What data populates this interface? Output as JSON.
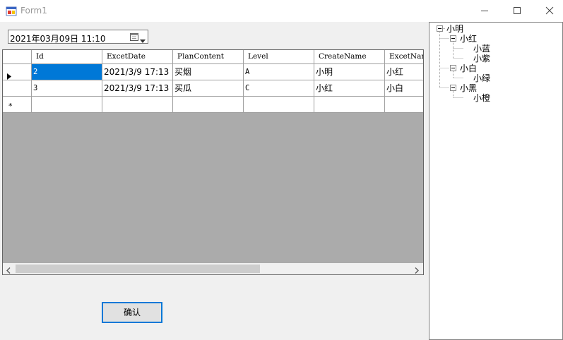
{
  "window": {
    "title": "Form1"
  },
  "datepicker": {
    "value": "2021年03月09日 11:10"
  },
  "grid": {
    "columns": [
      "Id",
      "ExcetDate",
      "PlanContent",
      "Level",
      "CreateName",
      "ExcetNam"
    ],
    "rows": [
      [
        "2",
        "2021/3/9 17:13",
        "买烟",
        "A",
        "小明",
        "小红"
      ],
      [
        "3",
        "2021/3/9 17:13",
        "买瓜",
        "C",
        "小红",
        "小白"
      ]
    ],
    "new_row_marker": "*"
  },
  "confirm_button": {
    "label": "确认"
  },
  "tree": {
    "root": "小明",
    "level1": [
      "小红",
      "小白",
      "小黑"
    ],
    "children": {
      "xiaohong": [
        "小蓝",
        "小紫"
      ],
      "xiaobai": [
        "小绿"
      ],
      "xiaohei": [
        "小橙"
      ]
    }
  },
  "colors": {
    "selection": "#0078d7",
    "grid_background": "#ababab"
  }
}
